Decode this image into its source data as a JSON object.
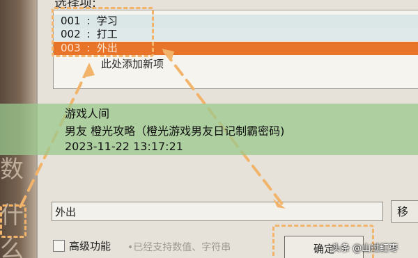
{
  "dialog": {
    "select_label": "选择项:",
    "list_items": [
      {
        "code": "001",
        "sep": ":",
        "label": "学习"
      },
      {
        "code": "002",
        "sep": ":",
        "label": "打工"
      },
      {
        "code": "003",
        "sep": ":",
        "label": "外出"
      }
    ],
    "add_new_item": "此处添加新项",
    "input_value": "外出",
    "side_button": "移",
    "advanced_label": "高级功能",
    "advanced_hint": "•已经支持数值、字符串",
    "ok_button": "确定"
  },
  "left_chars": [
    "数",
    "什么"
  ],
  "caption": {
    "line1": "游戏人间",
    "line2": "男友 橙光攻略（橙光游戏男友日记制霸密码)",
    "line3": "2023-11-22 13:17:21"
  },
  "watermark": "头条 @山过红枣",
  "colors": {
    "selected_row": "#e8742a",
    "highlight_dash": "#f1b46a",
    "caption_band": "#9ac98e"
  }
}
